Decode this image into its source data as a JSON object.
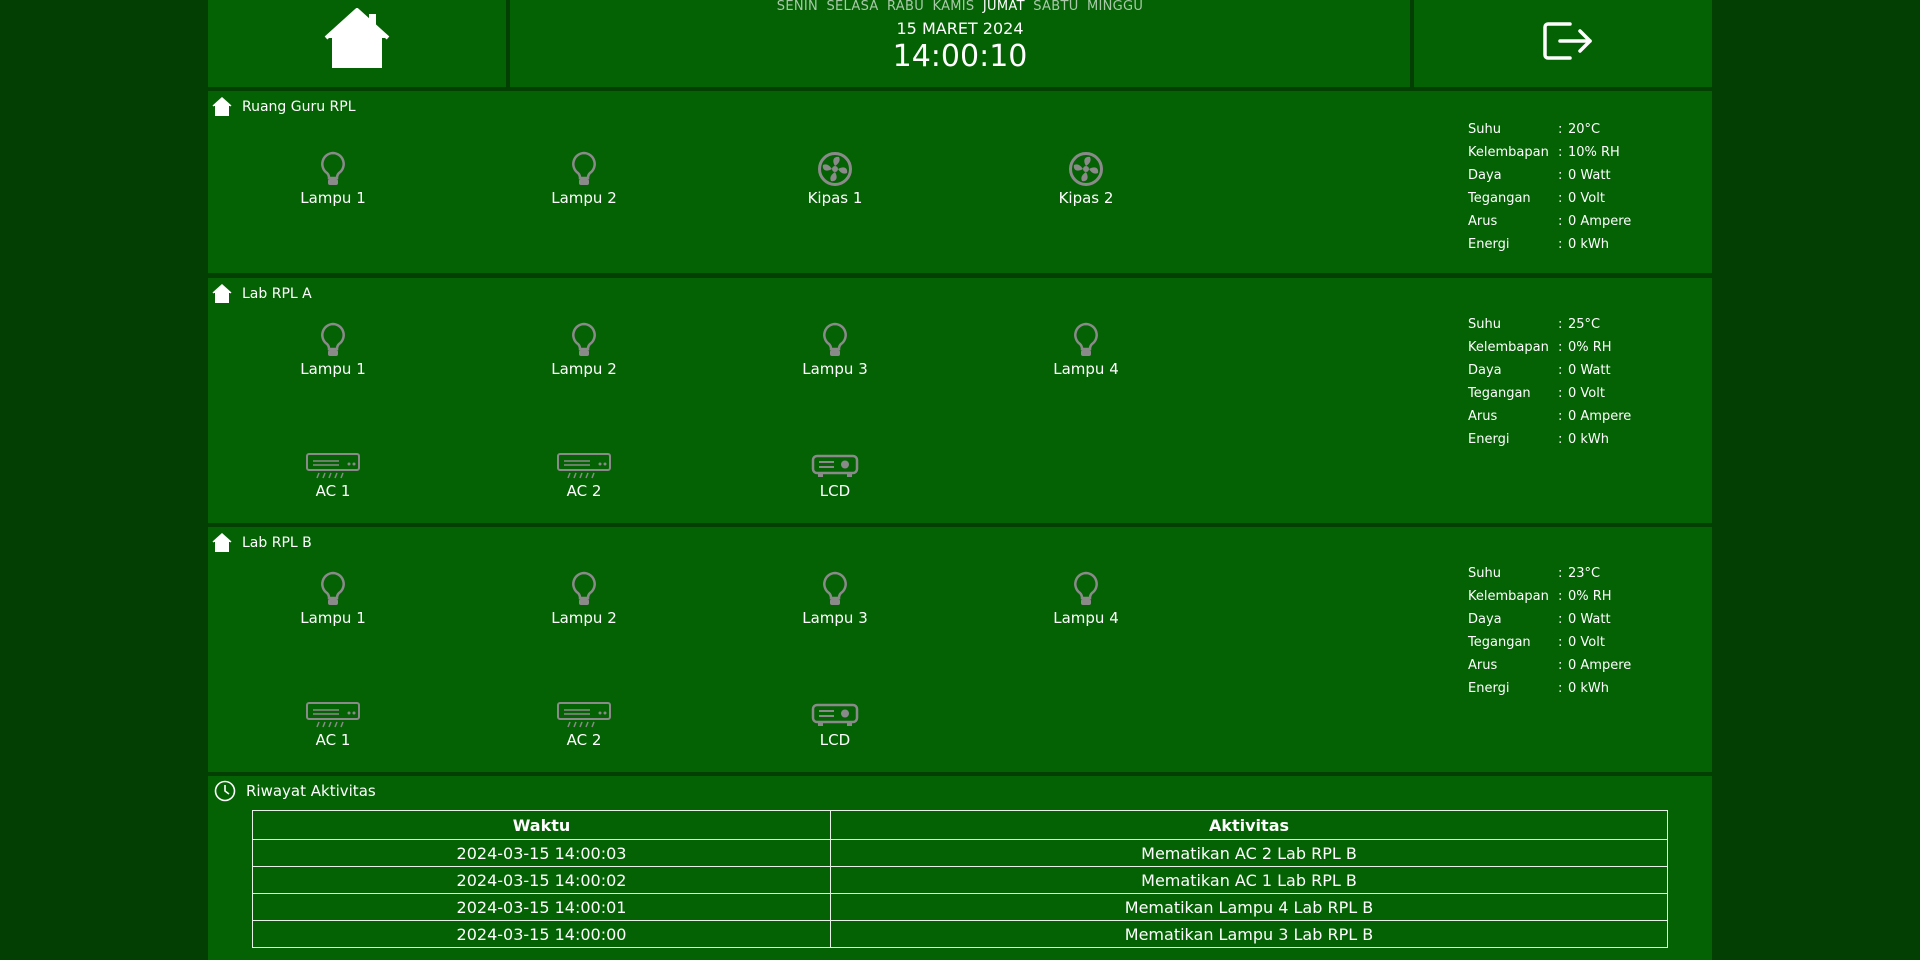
{
  "header": {
    "days": [
      {
        "label": "SENIN",
        "active": false
      },
      {
        "label": "SELASA",
        "active": false
      },
      {
        "label": "RABU",
        "active": false
      },
      {
        "label": "KAMIS",
        "active": false
      },
      {
        "label": "JUMAT",
        "active": true
      },
      {
        "label": "SABTU",
        "active": false
      },
      {
        "label": "MINGGU",
        "active": false
      }
    ],
    "date": "15 MARET 2024",
    "time": "14:00:10"
  },
  "rooms": [
    {
      "name": "Ruang Guru RPL",
      "devices": [
        {
          "label": "Lampu 1",
          "icon": "bulb-icon"
        },
        {
          "label": "Lampu 2",
          "icon": "bulb-icon"
        },
        {
          "label": "Kipas 1",
          "icon": "fan-icon"
        },
        {
          "label": "Kipas 2",
          "icon": "fan-icon"
        }
      ],
      "stats": {
        "suhu": {
          "label": "Suhu",
          "value": "20°C"
        },
        "kelembapan": {
          "label": "Kelembapan",
          "value": "10% RH"
        },
        "daya": {
          "label": "Daya",
          "value": "0 Watt"
        },
        "tegangan": {
          "label": "Tegangan",
          "value": "0 Volt"
        },
        "arus": {
          "label": "Arus",
          "value": "0 Ampere"
        },
        "energi": {
          "label": "Energi",
          "value": "0 kWh"
        }
      }
    },
    {
      "name": "Lab RPL A",
      "devices": [
        {
          "label": "Lampu 1",
          "icon": "bulb-icon"
        },
        {
          "label": "Lampu 2",
          "icon": "bulb-icon"
        },
        {
          "label": "Lampu 3",
          "icon": "bulb-icon"
        },
        {
          "label": "Lampu 4",
          "icon": "bulb-icon"
        },
        {
          "label": "AC 1",
          "icon": "ac-icon"
        },
        {
          "label": "AC 2",
          "icon": "ac-icon"
        },
        {
          "label": "LCD",
          "icon": "projector-icon"
        }
      ],
      "stats": {
        "suhu": {
          "label": "Suhu",
          "value": "25°C"
        },
        "kelembapan": {
          "label": "Kelembapan",
          "value": "0% RH"
        },
        "daya": {
          "label": "Daya",
          "value": "0 Watt"
        },
        "tegangan": {
          "label": "Tegangan",
          "value": "0 Volt"
        },
        "arus": {
          "label": "Arus",
          "value": "0 Ampere"
        },
        "energi": {
          "label": "Energi",
          "value": "0 kWh"
        }
      }
    },
    {
      "name": "Lab RPL B",
      "devices": [
        {
          "label": "Lampu 1",
          "icon": "bulb-icon"
        },
        {
          "label": "Lampu 2",
          "icon": "bulb-icon"
        },
        {
          "label": "Lampu 3",
          "icon": "bulb-icon"
        },
        {
          "label": "Lampu 4",
          "icon": "bulb-icon"
        },
        {
          "label": "AC 1",
          "icon": "ac-icon"
        },
        {
          "label": "AC 2",
          "icon": "ac-icon"
        },
        {
          "label": "LCD",
          "icon": "projector-icon"
        }
      ],
      "stats": {
        "suhu": {
          "label": "Suhu",
          "value": "23°C"
        },
        "kelembapan": {
          "label": "Kelembapan",
          "value": "0% RH"
        },
        "daya": {
          "label": "Daya",
          "value": "0 Watt"
        },
        "tegangan": {
          "label": "Tegangan",
          "value": "0 Volt"
        },
        "arus": {
          "label": "Arus",
          "value": "0 Ampere"
        },
        "energi": {
          "label": "Energi",
          "value": "0 kWh"
        }
      }
    }
  ],
  "history": {
    "title": "Riwayat Aktivitas",
    "headers": {
      "time": "Waktu",
      "activity": "Aktivitas"
    },
    "rows": [
      {
        "time": "2024-03-15 14:00:03",
        "activity": "Mematikan AC 2 Lab RPL B"
      },
      {
        "time": "2024-03-15 14:00:02",
        "activity": "Mematikan AC 1 Lab RPL B"
      },
      {
        "time": "2024-03-15 14:00:01",
        "activity": "Mematikan Lampu 4 Lab RPL B"
      },
      {
        "time": "2024-03-15 14:00:00",
        "activity": "Mematikan Lampu 3 Lab RPL B"
      }
    ]
  },
  "colors": {
    "background": "#033e03",
    "panel": "#046204",
    "device_off": "#8a8a8a",
    "text": "#ffffff"
  }
}
